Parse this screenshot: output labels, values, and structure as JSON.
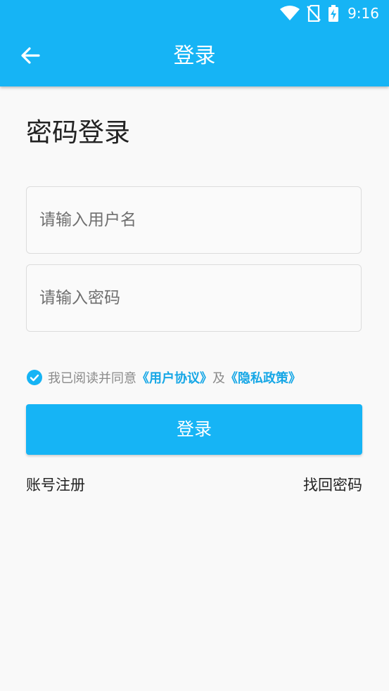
{
  "status_bar": {
    "time": "9:16"
  },
  "header": {
    "title": "登录"
  },
  "page": {
    "heading": "密码登录"
  },
  "form": {
    "username_placeholder": "请输入用户名",
    "username_value": "",
    "password_placeholder": "请输入密码",
    "password_value": ""
  },
  "agreement": {
    "checked": true,
    "prefix": "我已阅读并同意",
    "user_agreement": "《用户协议》",
    "and": "及",
    "privacy_policy": "《隐私政策》"
  },
  "actions": {
    "login_label": "登录",
    "register_label": "账号注册",
    "forgot_label": "找回密码"
  },
  "colors": {
    "primary": "#16b4f5",
    "link": "#16a7e6",
    "background": "#f9f9f9"
  },
  "icons": {
    "back": "arrow-left-icon",
    "wifi": "wifi-icon",
    "no_sim": "no-sim-icon",
    "battery": "battery-charging-icon",
    "checkbox": "check-circle-icon"
  }
}
